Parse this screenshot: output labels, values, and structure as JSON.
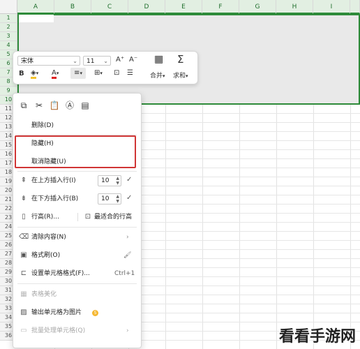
{
  "sheet": {
    "columns": [
      "A",
      "B",
      "C",
      "D",
      "E",
      "F",
      "G",
      "H",
      "I"
    ],
    "rows": [
      "1",
      "2",
      "3",
      "4",
      "5",
      "6",
      "7",
      "8",
      "9",
      "10",
      "11",
      "12",
      "13",
      "14",
      "15",
      "16",
      "17",
      "18",
      "19",
      "20",
      "21",
      "22",
      "23",
      "24",
      "25",
      "26",
      "27",
      "28",
      "29",
      "30",
      "31",
      "32",
      "33",
      "34",
      "35",
      "36"
    ]
  },
  "toolbar": {
    "font_name": "宋体",
    "font_size": "11",
    "increase_font": "A⁺",
    "decrease_font": "A⁻",
    "bold": "B",
    "merge_label": "合并",
    "sum_label": "求和"
  },
  "menu": {
    "delete": "删除(D)",
    "hide": "隐藏(H)",
    "unhide": "取消隐藏(U)",
    "insert_above": "在上方插入行(I)",
    "insert_above_value": "10",
    "insert_below": "在下方插入行(B)",
    "insert_below_value": "10",
    "row_height": "行高(R)...",
    "best_fit": "最适合的行高",
    "clear_contents": "清除内容(N)",
    "format_painter": "格式刷(O)",
    "format_cells": "设置单元格格式(F)...",
    "format_cells_shortcut": "Ctrl+1",
    "beautify": "表格美化",
    "export_image": "输出单元格为图片",
    "batch_process": "批量处理单元格(Q)"
  },
  "watermark": "看看手游网",
  "colors": {
    "accent": "#2e8b3a",
    "highlight_box": "#d03535"
  }
}
